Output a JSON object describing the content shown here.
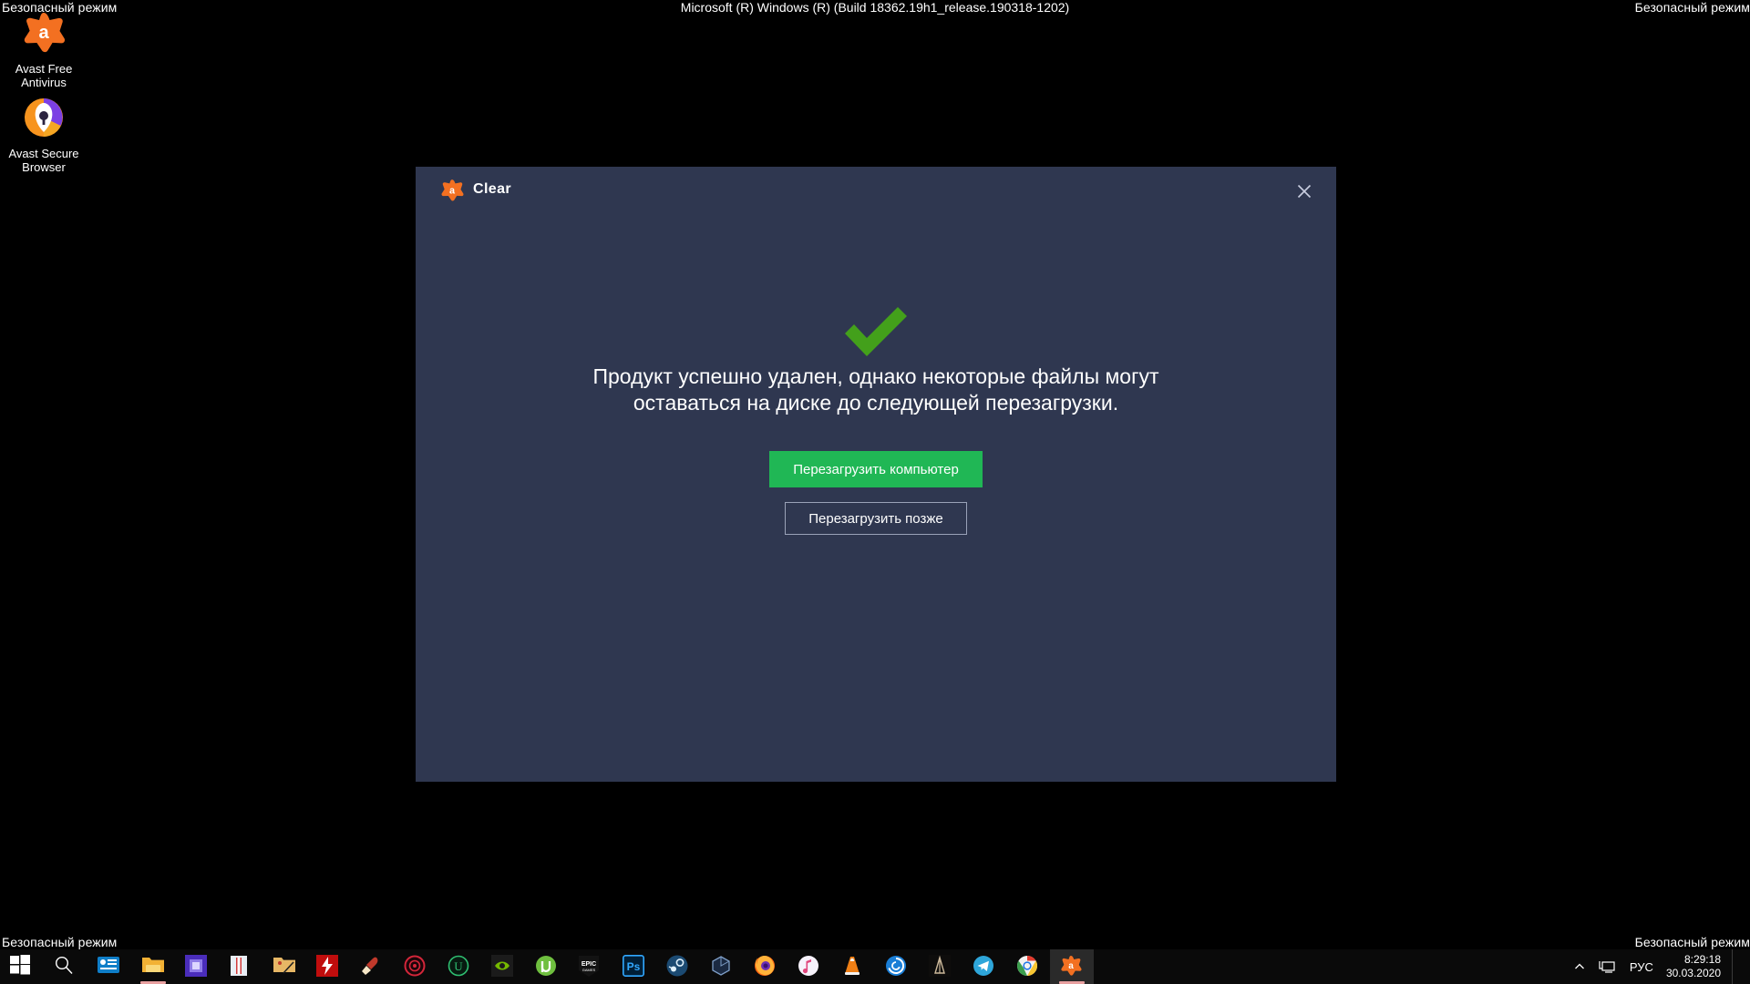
{
  "desktop": {
    "watermarks": {
      "top_left": "Безопасный режим",
      "top_right": "Безопасный режим",
      "bottom_left": "Безопасный режим",
      "bottom_right": "Безопасный режим",
      "build": "Microsoft (R) Windows (R) (Build 18362.19h1_release.190318-1202)"
    },
    "icons": [
      {
        "name": "avast-free-antivirus",
        "label": "Avast Free\nAntivirus",
        "label_line1": "Avast Free",
        "label_line2": "Antivirus",
        "glyph": "avast-logo-icon"
      },
      {
        "name": "avast-secure-browser",
        "label": "Avast Secure\nBrowser",
        "label_line1": "Avast Secure",
        "label_line2": "Browser",
        "glyph": "avast-browser-icon"
      }
    ]
  },
  "dialog": {
    "title": "Clear",
    "logo_icon": "avast-logo-icon",
    "close_icon": "close-icon",
    "status_icon": "checkmark-icon",
    "status_color": "#43a01b",
    "message_line1": "Продукт успешно удален, однако некоторые файлы могут",
    "message_line2": "оставаться на диске до следующей перезагрузки.",
    "primary_button": "Перезагрузить компьютер",
    "secondary_button": "Перезагрузить позже",
    "colors": {
      "background": "#2f3750",
      "primary_button": "#20b755",
      "secondary_border": "#9aa2b8",
      "text": "#ffffff"
    }
  },
  "taskbar": {
    "items": [
      {
        "name": "start-button",
        "icon": "windows-logo-icon",
        "active": false,
        "underline": false
      },
      {
        "name": "search-button",
        "icon": "search-icon",
        "active": false,
        "underline": false
      },
      {
        "name": "task-view-button",
        "icon": "task-view-icon",
        "active": false,
        "underline": false
      },
      {
        "name": "file-explorer",
        "icon": "folder-icon",
        "active": false,
        "underline": true
      },
      {
        "name": "cpu-z",
        "icon": "cpu-chip-icon",
        "active": false,
        "underline": false
      },
      {
        "name": "thermometer-app",
        "icon": "thermometer-icon",
        "active": false,
        "underline": false
      },
      {
        "name": "photo-editor",
        "icon": "photo-folder-icon",
        "active": false,
        "underline": false
      },
      {
        "name": "flash-app",
        "icon": "red-lightning-icon",
        "active": false,
        "underline": false
      },
      {
        "name": "ccleaner",
        "icon": "broom-icon",
        "active": false,
        "underline": false
      },
      {
        "name": "iobit-uninstaller",
        "icon": "red-target-icon",
        "active": false,
        "underline": false
      },
      {
        "name": "uninstall-tool",
        "icon": "green-u-icon",
        "active": false,
        "underline": false
      },
      {
        "name": "nvidia-control-panel",
        "icon": "nvidia-eye-icon",
        "active": false,
        "underline": false
      },
      {
        "name": "utorrent",
        "icon": "utorrent-icon",
        "active": false,
        "underline": false
      },
      {
        "name": "epic-games",
        "icon": "epic-games-icon",
        "active": false,
        "underline": false
      },
      {
        "name": "photoshop",
        "icon": "photoshop-icon",
        "active": false,
        "underline": false
      },
      {
        "name": "steam",
        "icon": "steam-icon",
        "active": false,
        "underline": false
      },
      {
        "name": "virtualbox",
        "icon": "virtualbox-icon",
        "active": false,
        "underline": false
      },
      {
        "name": "firefox",
        "icon": "firefox-icon",
        "active": false,
        "underline": false
      },
      {
        "name": "itunes",
        "icon": "itunes-icon",
        "active": false,
        "underline": false
      },
      {
        "name": "vlc",
        "icon": "vlc-cone-icon",
        "active": false,
        "underline": false
      },
      {
        "name": "ubisoft-connect",
        "icon": "ubisoft-spiral-icon",
        "active": false,
        "underline": false
      },
      {
        "name": "game-launcher",
        "icon": "game-arrow-icon",
        "active": false,
        "underline": false
      },
      {
        "name": "telegram",
        "icon": "telegram-icon",
        "active": false,
        "underline": false
      },
      {
        "name": "chrome",
        "icon": "chrome-icon",
        "active": false,
        "underline": false
      },
      {
        "name": "avast-uninstall",
        "icon": "avast-logo-icon",
        "active": true,
        "underline": true
      }
    ],
    "tray": {
      "chevron_icon": "chevron-up-icon",
      "network_icon": "network-monitor-icon",
      "language": "РУС",
      "time": "8:29:18",
      "date": "30.03.2020"
    }
  }
}
